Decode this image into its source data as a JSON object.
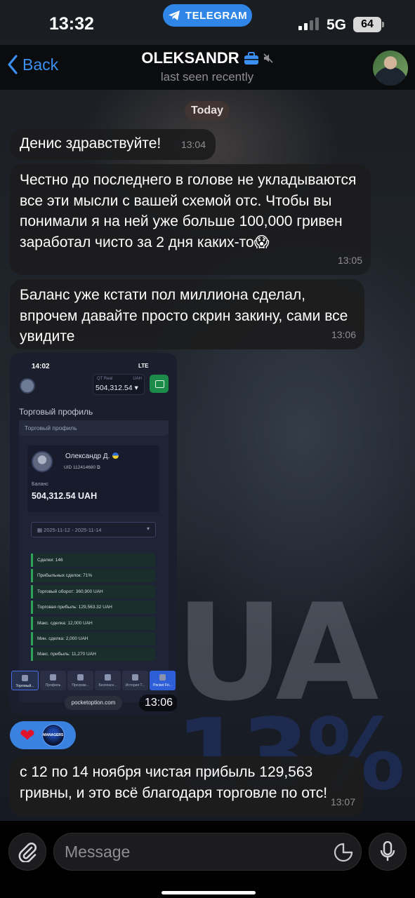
{
  "status_bar": {
    "time": "13:32",
    "telegram_label": "TELEGRAM",
    "network": "5G",
    "battery": "64"
  },
  "header": {
    "back_label": "Back",
    "contact_name": "OLEKSANDR",
    "last_seen": "last seen recently"
  },
  "date_separator": "Today",
  "messages": [
    {
      "text": "Денис здравствуйте!",
      "time": "13:04"
    },
    {
      "text": "Честно до последнего в голове не укладываются все эти мысли с вашей схемой отс. Чтобы вы понимали я на ней уже больше 100,000 гривен заработал чисто за 2 дня каких-то😱",
      "time": "13:05"
    },
    {
      "text": "Баланс уже кстати пол миллиона сделал, впрочем давайте просто скрин закину, сами все увидите",
      "time": "13:06"
    },
    {
      "text": "с 12 по 14 ноября чистая прибыль 129,563 гривны, и это всё благодаря торговле по отс!",
      "time": "13:07"
    }
  ],
  "screenshot": {
    "time": "13:06",
    "phone_time": "14:02",
    "network": "LTE",
    "account_type": "QT Real",
    "currency": "UAH",
    "account_balance": "504,312.54",
    "section_title": "Торговый профиль",
    "tab_label": "Торговый профиль",
    "user_name": "Олександр Д.",
    "uid": "UID 112414680",
    "balance_label": "Баланс",
    "balance_value": "504,312.54 UAH",
    "date_range": "2025-11-12 - 2025-11-14",
    "stats": [
      "Сделки: 146",
      "Прибыльных сделок: 71%",
      "Торговый оборот: 360,900 UAH",
      "Торговая прибыль: 129,563.32 UAH",
      "Макс. сделка: 12,000 UAH",
      "Мин. сделка: 2,000 UAH",
      "Макс. прибыль: 11,270 UAH"
    ],
    "nav_items": [
      "Торговый...",
      "Профиль",
      "Програм...",
      "Безопасн...",
      "История Т...",
      "Pocket Fri..."
    ],
    "url": "pocketoption.com"
  },
  "reactions": {
    "emoji": "❤",
    "avatar_label": "MANAGERS"
  },
  "wallpaper_text": {
    "big": "UA",
    "percent": "13%"
  },
  "input": {
    "placeholder": "Message"
  },
  "colors": {
    "accent": "#3b8ff0",
    "telegram_pill": "#2f86e6",
    "bubble": "#1c1c1e",
    "reaction_pill": "#3a82e0"
  }
}
